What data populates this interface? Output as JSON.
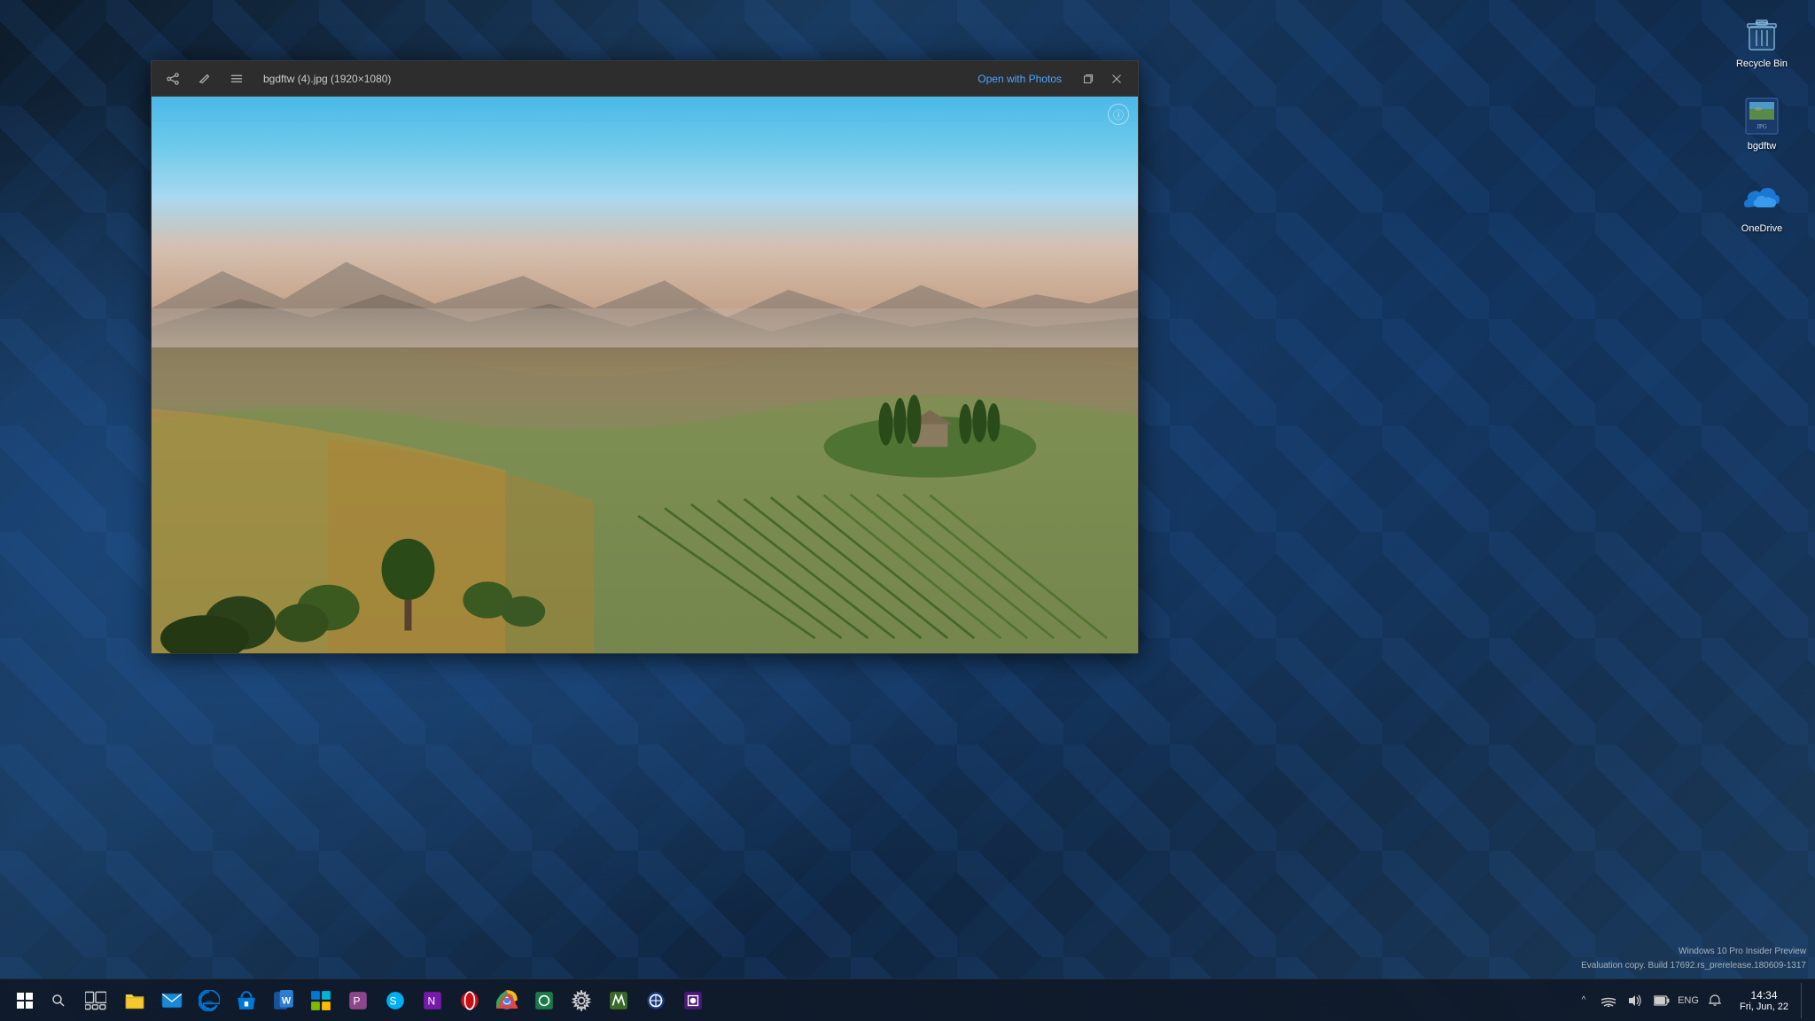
{
  "desktop": {
    "background": "dark blue geometric Windows 10 wallpaper"
  },
  "desktop_icons": [
    {
      "id": "recycle-bin",
      "label": "Recycle Bin",
      "type": "system"
    },
    {
      "id": "bgdftw",
      "label": "bgdftw",
      "type": "file"
    },
    {
      "id": "onedrive",
      "label": "OneDrive",
      "type": "cloud"
    }
  ],
  "photo_viewer": {
    "title": "bgdftw (4).jpg (1920×1080)",
    "open_with_label": "Open with Photos",
    "info_button": "ⓘ",
    "toolbar_icons": [
      "share",
      "pencil",
      "list"
    ],
    "window_controls": [
      "expand",
      "close"
    ]
  },
  "taskbar": {
    "start_icon": "⊞",
    "search_icon": "🔍",
    "apps": [
      {
        "id": "task-view",
        "label": "Task View"
      },
      {
        "id": "file-explorer",
        "label": "File Explorer"
      },
      {
        "id": "mail",
        "label": "Mail"
      },
      {
        "id": "edge",
        "label": "Microsoft Edge"
      },
      {
        "id": "store",
        "label": "Store"
      },
      {
        "id": "word",
        "label": "Word"
      },
      {
        "id": "control-panel",
        "label": "Control Panel"
      },
      {
        "id": "app8",
        "label": "App"
      },
      {
        "id": "app9",
        "label": "Skype"
      },
      {
        "id": "onenote",
        "label": "OneNote"
      },
      {
        "id": "opera",
        "label": "Opera"
      },
      {
        "id": "chrome",
        "label": "Chrome"
      },
      {
        "id": "app12",
        "label": "App"
      },
      {
        "id": "settings",
        "label": "Settings"
      },
      {
        "id": "app14",
        "label": "App"
      },
      {
        "id": "app15",
        "label": "App"
      },
      {
        "id": "app16",
        "label": "App"
      }
    ],
    "system_tray": {
      "expand_label": "^",
      "notification": "🔔",
      "network": "📶",
      "volume": "🔊",
      "battery": "🔋",
      "language": "ENG"
    },
    "clock": {
      "time": "14:34",
      "date": "Fri, Jun, 22"
    },
    "win10_info": {
      "line1": "Windows 10 Pro Insider Preview",
      "line2": "Evaluation copy. Build 17692.rs_prerelease.180609-1317"
    }
  }
}
